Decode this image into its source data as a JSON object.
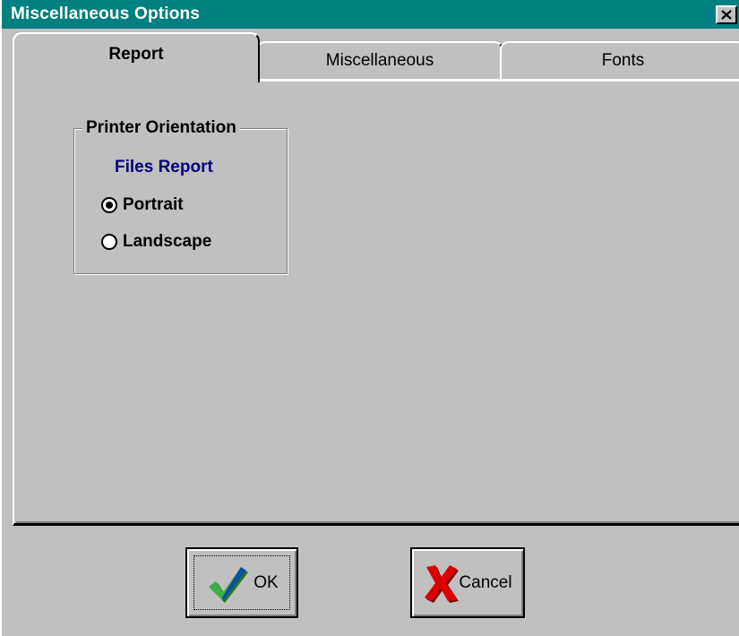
{
  "window": {
    "title": "Miscellaneous Options"
  },
  "tabs": [
    {
      "label": "Report",
      "active": true
    },
    {
      "label": "Miscellaneous",
      "active": false
    },
    {
      "label": "Fonts",
      "active": false
    }
  ],
  "orientation_group": {
    "title": "Printer Orientation",
    "sublabel": "Files Report",
    "options": [
      {
        "label": "Portrait",
        "checked": true
      },
      {
        "label": "Landscape",
        "checked": false
      }
    ]
  },
  "buttons": {
    "ok_label": "OK",
    "cancel_label": "Cancel"
  },
  "colors": {
    "titlebar": "#008080",
    "face": "#c0c0c0",
    "sublabel": "#000080",
    "ok_check": "#2a9d2a",
    "cancel_x": "#cc0000"
  },
  "icons": {
    "close": "close-icon",
    "ok": "checkmark-icon",
    "cancel": "red-x-icon"
  }
}
